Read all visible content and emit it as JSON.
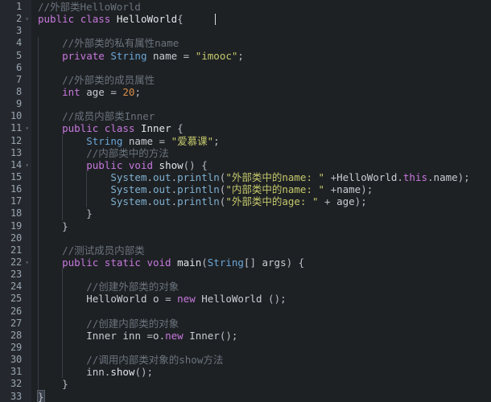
{
  "editor": {
    "language": "Java",
    "theme_name": "dark",
    "colors": {
      "background": "#1e2124",
      "gutter_background": "#24282e",
      "line_number": "#9aa4b0",
      "comment": "#6a737d",
      "keyword": "#c678dd",
      "type": "#6aa7d8",
      "string": "#c5c96b",
      "number": "#d98e48",
      "identifier": "#c9ccd1",
      "api_member": "#7fb0cf",
      "indent_guide": "#3a3f46"
    },
    "first_line": 1,
    "last_line": 33,
    "total_lines": 33,
    "fold_markers_on_lines": [
      2,
      11,
      14,
      22
    ],
    "cursor": {
      "line": 2,
      "column": 25
    }
  },
  "lines": [
    {
      "n": "1",
      "indent": 0,
      "fold": "",
      "tokens": [
        {
          "t": "//外部类HelloWorld",
          "c": "t-comment"
        }
      ]
    },
    {
      "n": "2",
      "indent": 0,
      "fold": "▾",
      "tokens": [
        {
          "t": "public",
          "c": "t-kw"
        },
        {
          "t": " ",
          "c": "t-punct"
        },
        {
          "t": "class",
          "c": "t-kw"
        },
        {
          "t": " ",
          "c": "t-punct"
        },
        {
          "t": "HelloWorld",
          "c": "t-func"
        },
        {
          "t": "{",
          "c": "t-punct"
        }
      ]
    },
    {
      "n": "3",
      "indent": 0,
      "fold": "",
      "tokens": []
    },
    {
      "n": "4",
      "indent": 1,
      "fold": "",
      "tokens": [
        {
          "t": "    //外部类的私有属性name",
          "c": "t-comment"
        }
      ]
    },
    {
      "n": "5",
      "indent": 1,
      "fold": "",
      "tokens": [
        {
          "t": "    ",
          "c": "t-punct"
        },
        {
          "t": "private",
          "c": "t-kw"
        },
        {
          "t": " ",
          "c": "t-punct"
        },
        {
          "t": "String",
          "c": "t-type"
        },
        {
          "t": " ",
          "c": "t-punct"
        },
        {
          "t": "name",
          "c": "t-ident"
        },
        {
          "t": " ",
          "c": "t-punct"
        },
        {
          "t": "=",
          "c": "t-op"
        },
        {
          "t": " ",
          "c": "t-punct"
        },
        {
          "t": "\"imooc\"",
          "c": "t-str"
        },
        {
          "t": ";",
          "c": "t-punct"
        }
      ]
    },
    {
      "n": "6",
      "indent": 1,
      "fold": "",
      "tokens": []
    },
    {
      "n": "7",
      "indent": 1,
      "fold": "",
      "tokens": [
        {
          "t": "    //外部类的成员属性",
          "c": "t-comment"
        }
      ]
    },
    {
      "n": "8",
      "indent": 1,
      "fold": "",
      "tokens": [
        {
          "t": "    ",
          "c": "t-punct"
        },
        {
          "t": "int",
          "c": "t-kw"
        },
        {
          "t": " ",
          "c": "t-punct"
        },
        {
          "t": "age",
          "c": "t-ident"
        },
        {
          "t": " ",
          "c": "t-punct"
        },
        {
          "t": "=",
          "c": "t-op"
        },
        {
          "t": " ",
          "c": "t-punct"
        },
        {
          "t": "20",
          "c": "t-num"
        },
        {
          "t": ";",
          "c": "t-punct"
        }
      ]
    },
    {
      "n": "9",
      "indent": 1,
      "fold": "",
      "tokens": []
    },
    {
      "n": "10",
      "indent": 1,
      "fold": "",
      "tokens": [
        {
          "t": "    //成员内部类Inner",
          "c": "t-comment"
        }
      ]
    },
    {
      "n": "11",
      "indent": 1,
      "fold": "▾",
      "tokens": [
        {
          "t": "    ",
          "c": "t-punct"
        },
        {
          "t": "public",
          "c": "t-kw"
        },
        {
          "t": " ",
          "c": "t-punct"
        },
        {
          "t": "class",
          "c": "t-kw"
        },
        {
          "t": " ",
          "c": "t-punct"
        },
        {
          "t": "Inner",
          "c": "t-func"
        },
        {
          "t": " {",
          "c": "t-punct"
        }
      ]
    },
    {
      "n": "12",
      "indent": 2,
      "fold": "",
      "tokens": [
        {
          "t": "        ",
          "c": "t-punct"
        },
        {
          "t": "String",
          "c": "t-type"
        },
        {
          "t": " ",
          "c": "t-punct"
        },
        {
          "t": "name",
          "c": "t-ident"
        },
        {
          "t": " ",
          "c": "t-punct"
        },
        {
          "t": "=",
          "c": "t-op"
        },
        {
          "t": " ",
          "c": "t-punct"
        },
        {
          "t": "\"爱慕课\"",
          "c": "t-str"
        },
        {
          "t": ";",
          "c": "t-punct"
        }
      ]
    },
    {
      "n": "13",
      "indent": 2,
      "fold": "",
      "tokens": [
        {
          "t": "        //内部类中的方法",
          "c": "t-comment"
        }
      ]
    },
    {
      "n": "14",
      "indent": 2,
      "fold": "▾",
      "tokens": [
        {
          "t": "        ",
          "c": "t-punct"
        },
        {
          "t": "public",
          "c": "t-kw"
        },
        {
          "t": " ",
          "c": "t-punct"
        },
        {
          "t": "void",
          "c": "t-kw"
        },
        {
          "t": " ",
          "c": "t-punct"
        },
        {
          "t": "show",
          "c": "t-func"
        },
        {
          "t": "() {",
          "c": "t-punct"
        }
      ]
    },
    {
      "n": "15",
      "indent": 3,
      "fold": "",
      "tokens": [
        {
          "t": "            ",
          "c": "t-punct"
        },
        {
          "t": "System",
          "c": "t-api"
        },
        {
          "t": ".",
          "c": "t-punct"
        },
        {
          "t": "out",
          "c": "t-api"
        },
        {
          "t": ".",
          "c": "t-punct"
        },
        {
          "t": "println",
          "c": "t-api"
        },
        {
          "t": "(",
          "c": "t-punct"
        },
        {
          "t": "\"外部类中的name: \"",
          "c": "t-str"
        },
        {
          "t": " +",
          "c": "t-op"
        },
        {
          "t": "HelloWorld",
          "c": "t-ident"
        },
        {
          "t": ".",
          "c": "t-punct"
        },
        {
          "t": "this",
          "c": "t-this"
        },
        {
          "t": ".",
          "c": "t-punct"
        },
        {
          "t": "name",
          "c": "t-ident"
        },
        {
          "t": ");",
          "c": "t-punct"
        }
      ]
    },
    {
      "n": "16",
      "indent": 3,
      "fold": "",
      "tokens": [
        {
          "t": "            ",
          "c": "t-punct"
        },
        {
          "t": "System",
          "c": "t-api"
        },
        {
          "t": ".",
          "c": "t-punct"
        },
        {
          "t": "out",
          "c": "t-api"
        },
        {
          "t": ".",
          "c": "t-punct"
        },
        {
          "t": "println",
          "c": "t-api"
        },
        {
          "t": "(",
          "c": "t-punct"
        },
        {
          "t": "\"内部类中的name: \"",
          "c": "t-str"
        },
        {
          "t": " +",
          "c": "t-op"
        },
        {
          "t": "name",
          "c": "t-ident"
        },
        {
          "t": ");",
          "c": "t-punct"
        }
      ]
    },
    {
      "n": "17",
      "indent": 3,
      "fold": "",
      "tokens": [
        {
          "t": "            ",
          "c": "t-punct"
        },
        {
          "t": "System",
          "c": "t-api"
        },
        {
          "t": ".",
          "c": "t-punct"
        },
        {
          "t": "out",
          "c": "t-api"
        },
        {
          "t": ".",
          "c": "t-punct"
        },
        {
          "t": "println",
          "c": "t-api"
        },
        {
          "t": "(",
          "c": "t-punct"
        },
        {
          "t": "\"外部类中的age: \"",
          "c": "t-str"
        },
        {
          "t": " + ",
          "c": "t-op"
        },
        {
          "t": "age",
          "c": "t-ident"
        },
        {
          "t": ");",
          "c": "t-punct"
        }
      ]
    },
    {
      "n": "18",
      "indent": 2,
      "fold": "",
      "tokens": [
        {
          "t": "        }",
          "c": "t-punct"
        }
      ]
    },
    {
      "n": "19",
      "indent": 1,
      "fold": "",
      "tokens": [
        {
          "t": "    }",
          "c": "t-punct"
        }
      ]
    },
    {
      "n": "20",
      "indent": 1,
      "fold": "",
      "tokens": []
    },
    {
      "n": "21",
      "indent": 1,
      "fold": "",
      "tokens": [
        {
          "t": "    //测试成员内部类",
          "c": "t-comment"
        }
      ]
    },
    {
      "n": "22",
      "indent": 1,
      "fold": "▾",
      "tokens": [
        {
          "t": "    ",
          "c": "t-punct"
        },
        {
          "t": "public",
          "c": "t-kw"
        },
        {
          "t": " ",
          "c": "t-punct"
        },
        {
          "t": "static",
          "c": "t-kw"
        },
        {
          "t": " ",
          "c": "t-punct"
        },
        {
          "t": "void",
          "c": "t-kw"
        },
        {
          "t": " ",
          "c": "t-punct"
        },
        {
          "t": "main",
          "c": "t-func"
        },
        {
          "t": "(",
          "c": "t-punct"
        },
        {
          "t": "String",
          "c": "t-type"
        },
        {
          "t": "[] ",
          "c": "t-punct"
        },
        {
          "t": "args",
          "c": "t-ident"
        },
        {
          "t": ") {",
          "c": "t-punct"
        }
      ]
    },
    {
      "n": "23",
      "indent": 2,
      "fold": "",
      "tokens": []
    },
    {
      "n": "24",
      "indent": 2,
      "fold": "",
      "tokens": [
        {
          "t": "        //创建外部类的对象",
          "c": "t-comment"
        }
      ]
    },
    {
      "n": "25",
      "indent": 2,
      "fold": "",
      "tokens": [
        {
          "t": "        ",
          "c": "t-punct"
        },
        {
          "t": "HelloWorld",
          "c": "t-ident"
        },
        {
          "t": " ",
          "c": "t-punct"
        },
        {
          "t": "o",
          "c": "t-ident"
        },
        {
          "t": " ",
          "c": "t-punct"
        },
        {
          "t": "=",
          "c": "t-op"
        },
        {
          "t": " ",
          "c": "t-punct"
        },
        {
          "t": "new",
          "c": "t-kw"
        },
        {
          "t": " ",
          "c": "t-punct"
        },
        {
          "t": "HelloWorld",
          "c": "t-ident"
        },
        {
          "t": " ();",
          "c": "t-punct"
        }
      ]
    },
    {
      "n": "26",
      "indent": 2,
      "fold": "",
      "tokens": []
    },
    {
      "n": "27",
      "indent": 2,
      "fold": "",
      "tokens": [
        {
          "t": "        //创建内部类的对象",
          "c": "t-comment"
        }
      ]
    },
    {
      "n": "28",
      "indent": 2,
      "fold": "",
      "tokens": [
        {
          "t": "        ",
          "c": "t-punct"
        },
        {
          "t": "Inner",
          "c": "t-ident"
        },
        {
          "t": " ",
          "c": "t-punct"
        },
        {
          "t": "inn",
          "c": "t-ident"
        },
        {
          "t": " ",
          "c": "t-punct"
        },
        {
          "t": "=",
          "c": "t-op"
        },
        {
          "t": "o",
          "c": "t-ident"
        },
        {
          "t": ".",
          "c": "t-punct"
        },
        {
          "t": "new",
          "c": "t-kw"
        },
        {
          "t": " ",
          "c": "t-punct"
        },
        {
          "t": "Inner",
          "c": "t-ident"
        },
        {
          "t": "();",
          "c": "t-punct"
        }
      ]
    },
    {
      "n": "29",
      "indent": 2,
      "fold": "",
      "tokens": []
    },
    {
      "n": "30",
      "indent": 2,
      "fold": "",
      "tokens": [
        {
          "t": "        //调用内部类对象的show方法",
          "c": "t-comment"
        }
      ]
    },
    {
      "n": "31",
      "indent": 2,
      "fold": "",
      "tokens": [
        {
          "t": "        ",
          "c": "t-punct"
        },
        {
          "t": "inn",
          "c": "t-ident"
        },
        {
          "t": ".",
          "c": "t-punct"
        },
        {
          "t": "show",
          "c": "t-func"
        },
        {
          "t": "();",
          "c": "t-punct"
        }
      ]
    },
    {
      "n": "32",
      "indent": 1,
      "fold": "",
      "tokens": [
        {
          "t": "    }",
          "c": "t-punct"
        }
      ]
    },
    {
      "n": "33",
      "indent": 0,
      "fold": "",
      "highlight_brace": true,
      "tokens": [
        {
          "t": "}",
          "c": "t-punct"
        }
      ]
    }
  ]
}
